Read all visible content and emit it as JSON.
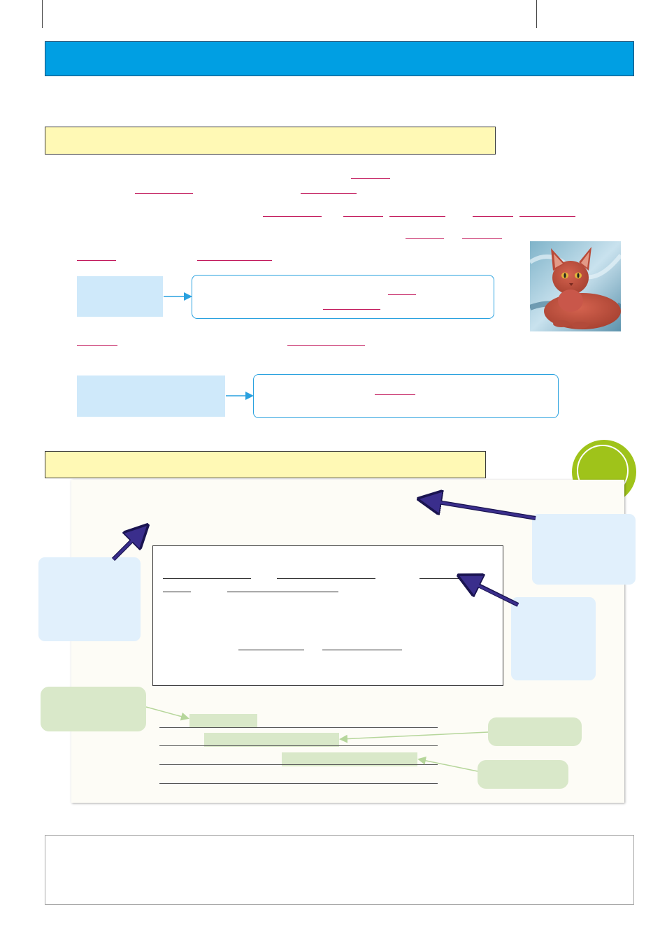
{
  "page": {
    "background": "#ffffff",
    "banner_color": "#009fe3",
    "section_color": "#fff9b5",
    "accent_underline": "#c2185b",
    "callout_blue": "#e1f0fc",
    "callout_green": "#d9e8c9",
    "badge_color": "#9fc31a"
  },
  "images": {
    "cat_photo": "photo-of-a-reddish-brown-cat-on-blue-fabric"
  }
}
